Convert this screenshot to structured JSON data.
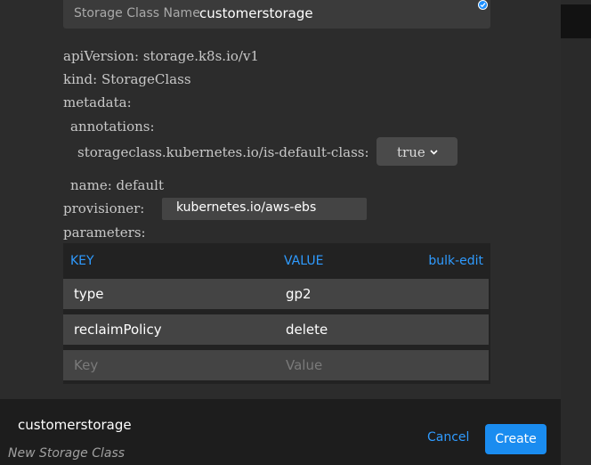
{
  "form": {
    "name_label": "Storage Class Name",
    "name_value": "customerstorage"
  },
  "yaml": {
    "api_version": "apiVersion: storage.k8s.io/v1",
    "kind": "kind: StorageClass",
    "metadata": "metadata:",
    "annotations": "annotations:",
    "default_class_key": "storageclass.kubernetes.io/is-default-class:",
    "default_class_value": "true",
    "name": "name: default",
    "provisioner_key": "provisioner:",
    "provisioner_value": "kubernetes.io/aws-ebs",
    "parameters": "parameters:"
  },
  "parameters_table": {
    "key_header": "KEY",
    "value_header": "VALUE",
    "bulk_edit": "bulk-edit",
    "rows": [
      {
        "key": "type",
        "value": "gp2"
      },
      {
        "key": "reclaimPolicy",
        "value": "delete"
      }
    ],
    "key_placeholder": "Key",
    "value_placeholder": "Value"
  },
  "footer": {
    "title": "customerstorage",
    "subtitle": "New Storage Class",
    "cancel_label": "Cancel",
    "create_label": "Create"
  },
  "colors": {
    "accent": "#1a8cf0",
    "link": "#2f9bff"
  }
}
